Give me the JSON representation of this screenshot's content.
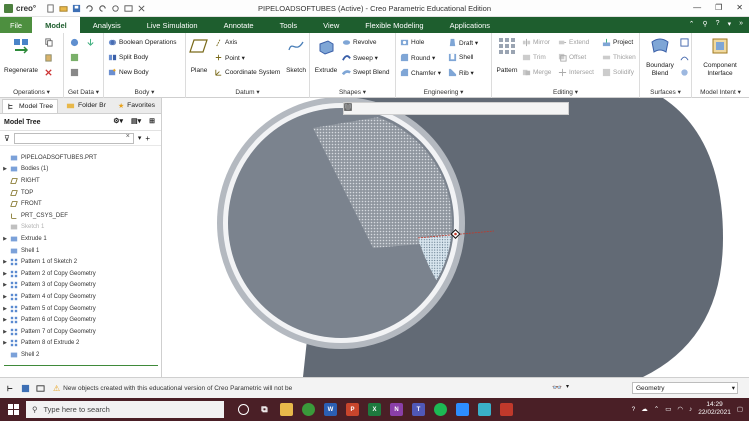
{
  "app": {
    "logo_text": "creo°",
    "window_title": "PIPELOADSOFTUBES (Active) - Creo Parametric Educational Edition"
  },
  "tabs": [
    {
      "label": "File"
    },
    {
      "label": "Model"
    },
    {
      "label": "Analysis"
    },
    {
      "label": "Live Simulation"
    },
    {
      "label": "Annotate"
    },
    {
      "label": "Tools"
    },
    {
      "label": "View"
    },
    {
      "label": "Flexible Modeling"
    },
    {
      "label": "Applications"
    }
  ],
  "ribbon": {
    "operations": {
      "label": "Operations ▾",
      "regenerate": "Regenerate"
    },
    "get_data": {
      "label": "Get Data ▾"
    },
    "body": {
      "label": "Body ▾",
      "boolean": "Boolean Operations",
      "split": "Split Body",
      "new": "New Body"
    },
    "datum": {
      "label": "Datum ▾",
      "plane": "Plane",
      "axis": "Axis",
      "point": "Point ▾",
      "csys": "Coordinate System",
      "sketch": "Sketch"
    },
    "shapes": {
      "label": "Shapes ▾",
      "extrude": "Extrude",
      "revolve": "Revolve",
      "sweep": "Sweep ▾",
      "swept_blend": "Swept Blend"
    },
    "engineering": {
      "label": "Engineering ▾",
      "hole": "Hole",
      "round": "Round ▾",
      "chamfer": "Chamfer ▾",
      "draft": "Draft ▾",
      "shell": "Shell",
      "rib": "Rib ▾"
    },
    "editing": {
      "label": "Editing ▾",
      "pattern": "Pattern",
      "mirror": "Mirror",
      "trim": "Trim",
      "merge": "Merge",
      "extend": "Extend",
      "offset": "Offset",
      "intersect": "Intersect",
      "project": "Project",
      "thicken": "Thicken",
      "solidify": "Solidify"
    },
    "surfaces": {
      "label": "Surfaces ▾",
      "boundary_blend": "Boundary Blend"
    },
    "model_intent": {
      "label": "Model Intent ▾",
      "component_interface": "Component Interface"
    }
  },
  "panel": {
    "tabs": [
      "Model Tree",
      "Folder Br",
      "Favorites"
    ],
    "header": "Model Tree",
    "filter_placeholder": ""
  },
  "tree": [
    {
      "label": "PIPELOADSOFTUBES.PRT",
      "exp": "",
      "dim": false
    },
    {
      "label": "Bodies (1)",
      "exp": "▶",
      "dim": false
    },
    {
      "label": "RIGHT",
      "exp": "",
      "dim": false
    },
    {
      "label": "TOP",
      "exp": "",
      "dim": false
    },
    {
      "label": "FRONT",
      "exp": "",
      "dim": false
    },
    {
      "label": "PRT_CSYS_DEF",
      "exp": "",
      "dim": false
    },
    {
      "label": "Sketch 1",
      "exp": "",
      "dim": true
    },
    {
      "label": "Extrude 1",
      "exp": "▶",
      "dim": false
    },
    {
      "label": "Shell 1",
      "exp": "",
      "dim": false
    },
    {
      "label": "Pattern 1 of Sketch 2",
      "exp": "▶",
      "dim": false
    },
    {
      "label": "Pattern 2 of Copy Geometry",
      "exp": "▶",
      "dim": false
    },
    {
      "label": "Pattern 3 of Copy Geometry",
      "exp": "▶",
      "dim": false
    },
    {
      "label": "Pattern 4 of Copy Geometry",
      "exp": "▶",
      "dim": false
    },
    {
      "label": "Pattern 5 of Copy Geometry",
      "exp": "▶",
      "dim": false
    },
    {
      "label": "Pattern 6 of Copy Geometry",
      "exp": "▶",
      "dim": false
    },
    {
      "label": "Pattern 7 of Copy Geometry",
      "exp": "▶",
      "dim": false
    },
    {
      "label": "Pattern 8 of Extrude 2",
      "exp": "▶",
      "dim": false
    },
    {
      "label": "Shell 2",
      "exp": "",
      "dim": false
    }
  ],
  "status": {
    "message": "New objects created with this educational version of Creo Parametric will not be",
    "filter_value": "Geometry"
  },
  "taskbar": {
    "search_placeholder": "Type here to search",
    "time": "14:29",
    "date": "22/02/2021"
  },
  "colors": {
    "tab_bar": "#1e5e2e",
    "file_tab": "#4d8f3f",
    "pipe_outer": "#5f6772",
    "pipe_inner": "#7d8591",
    "taskbar": "#4a1f26"
  }
}
